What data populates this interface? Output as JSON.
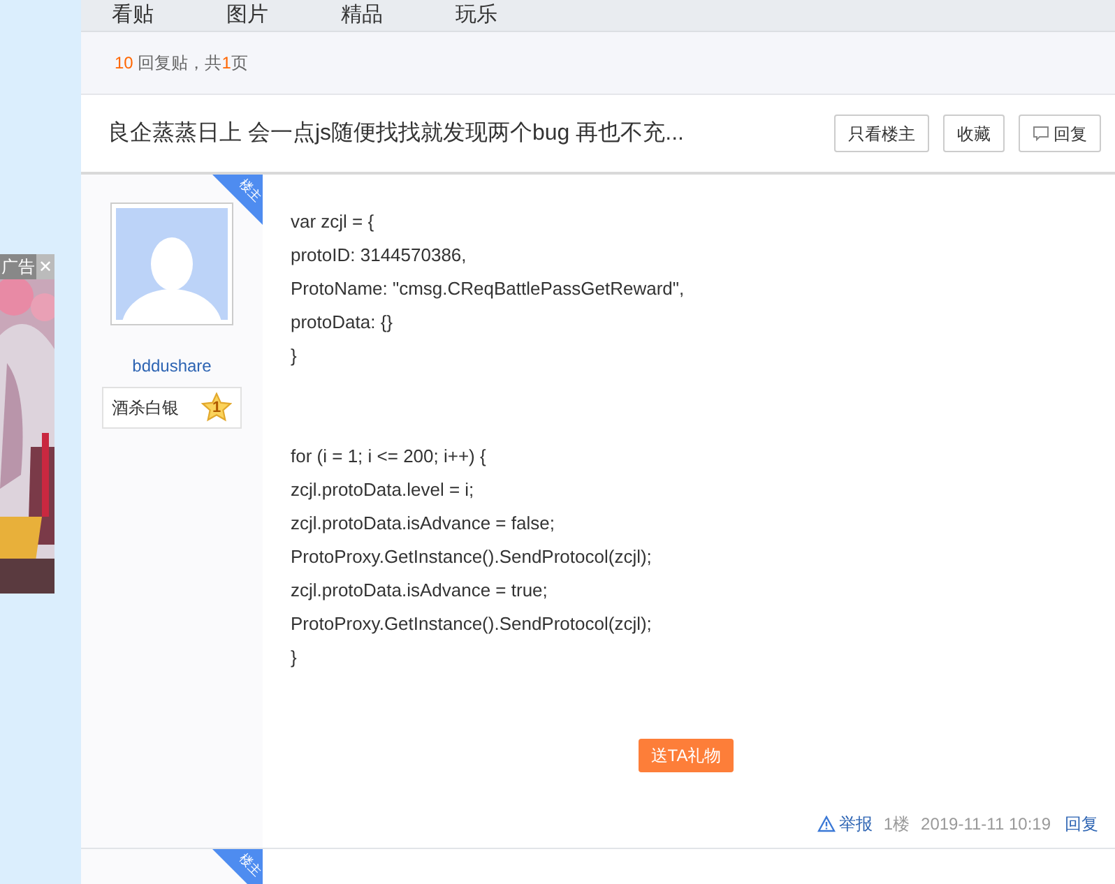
{
  "tabs": [
    {
      "label": "看贴"
    },
    {
      "label": "图片"
    },
    {
      "label": "精品"
    },
    {
      "label": "玩乐"
    }
  ],
  "summary": {
    "count": "10",
    "text_a": "回复贴，共",
    "pages": "1",
    "text_b": "页"
  },
  "title": "良企蒸蒸日上 会一点js随便找找就发现两个bug 再也不充...",
  "title_buttons": [
    {
      "label": "只看楼主",
      "kind": "plain"
    },
    {
      "label": "收藏",
      "kind": "plain"
    },
    {
      "label": "回复",
      "kind": "reply"
    }
  ],
  "ad": {
    "label": "广告",
    "close": "✕"
  },
  "posts": [
    {
      "badge": "楼主",
      "username": "bddushare",
      "rank_name": "酒杀白银",
      "rank_level": "1",
      "code_blocks": [
        [
          "var zcjl = {",
          "protoID: 3144570386,",
          "ProtoName: \"cmsg.CReqBattlePassGetReward\",",
          "protoData: {}",
          "}"
        ],
        [
          "for (i = 1; i <= 200; i++) {",
          "zcjl.protoData.level = i;",
          "zcjl.protoData.isAdvance = false;",
          "ProtoProxy.GetInstance().SendProtocol(zcjl);",
          "zcjl.protoData.isAdvance = true;",
          "ProtoProxy.GetInstance().SendProtocol(zcjl);",
          "}"
        ]
      ],
      "gift_button": "送TA礼物",
      "report": "举报",
      "floor": "1楼",
      "time": "2019-11-11 10:19",
      "reply": "回复"
    },
    {
      "badge": "楼主"
    }
  ]
}
